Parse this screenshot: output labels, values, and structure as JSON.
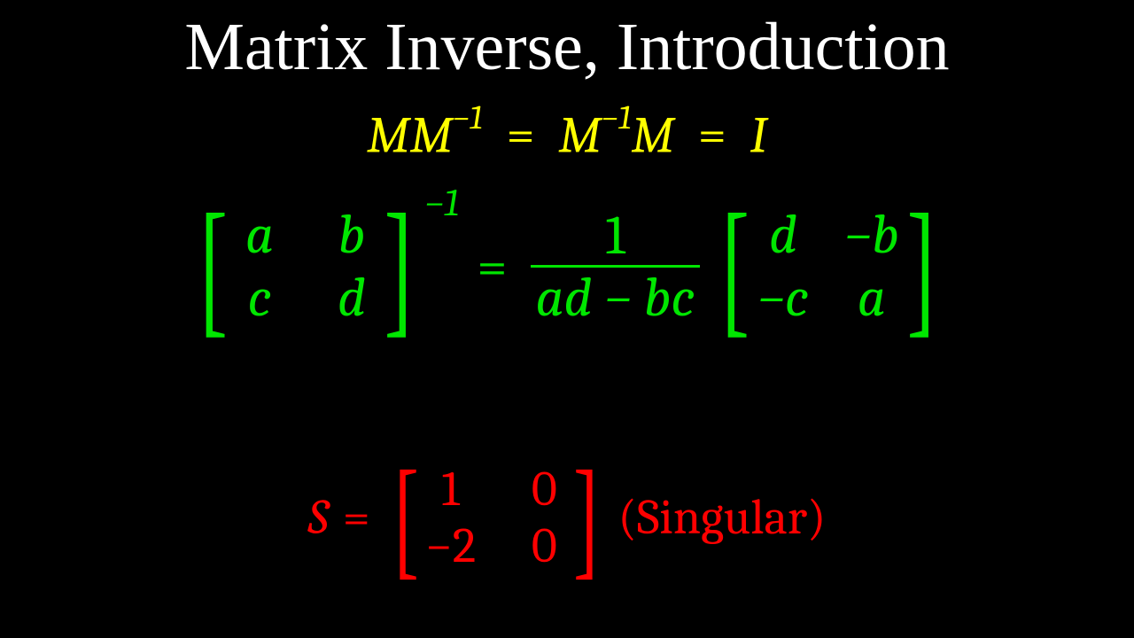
{
  "title": "Matrix Inverse, Introduction",
  "line1": {
    "M": "M",
    "inv": "−1",
    "eq": "=",
    "I": "I"
  },
  "green": {
    "a": "a",
    "b": "b",
    "c": "c",
    "d": "d",
    "neg_b": "−b",
    "neg_c": "−c",
    "inv": "−1",
    "eq": "=",
    "one": "1",
    "det": "ad − bc"
  },
  "red": {
    "S": "S",
    "eq": "=",
    "m11": "1",
    "m12": "0",
    "m21": "−2",
    "m22": "0",
    "label": "(Singular)"
  }
}
